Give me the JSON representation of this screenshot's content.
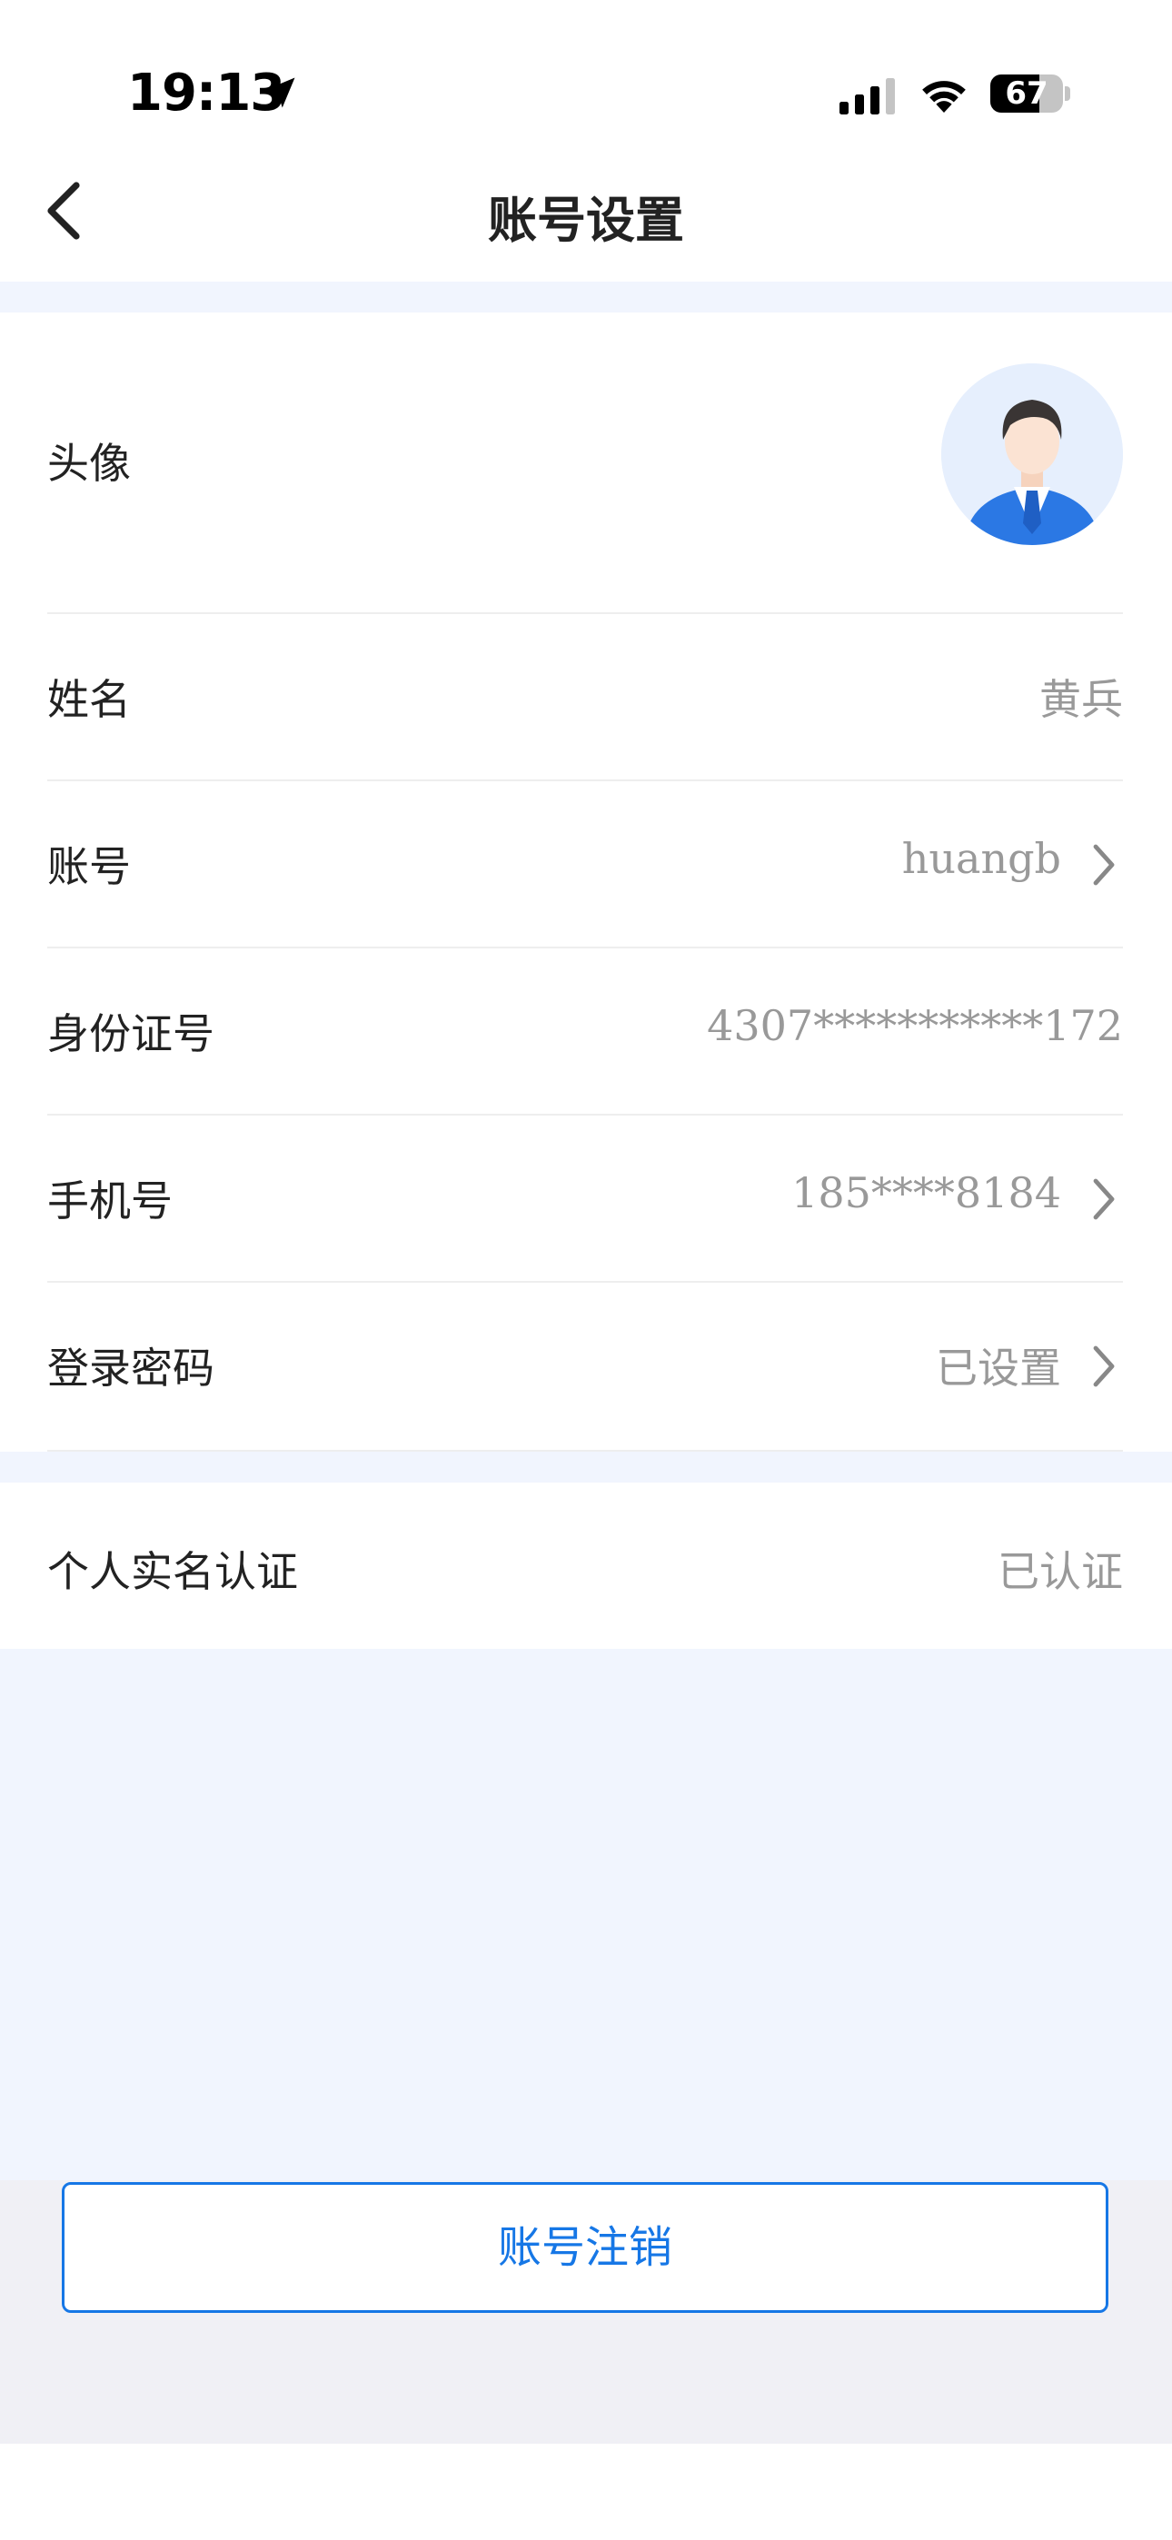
{
  "status_bar": {
    "time": "19:13",
    "battery_text": "67",
    "battery_level": 0.67,
    "location_icon": "location-arrow-icon",
    "signal_icon": "cellular-signal-icon",
    "wifi_icon": "wifi-icon"
  },
  "nav": {
    "title": "账号设置",
    "back_icon": "chevron-left-icon"
  },
  "profile": {
    "avatar_label": "头像",
    "avatar_icon": "user-avatar-icon",
    "rows": [
      {
        "label": "姓名",
        "value": "黄兵",
        "has_chevron": false
      },
      {
        "label": "账号",
        "value": "huangb",
        "has_chevron": true
      },
      {
        "label": "身份证号",
        "value": "4307***********172",
        "has_chevron": false
      },
      {
        "label": "手机号",
        "value": "185****8184",
        "has_chevron": true
      },
      {
        "label": "登录密码",
        "value": "已设置",
        "has_chevron": true
      }
    ]
  },
  "verification": {
    "label": "个人实名认证",
    "value": "已认证"
  },
  "footer": {
    "cancel_account_label": "账号注销"
  },
  "colors": {
    "accent": "#1677e6",
    "page_bg": "#f1f5fe",
    "label_text": "#222222",
    "value_text": "#999999"
  }
}
